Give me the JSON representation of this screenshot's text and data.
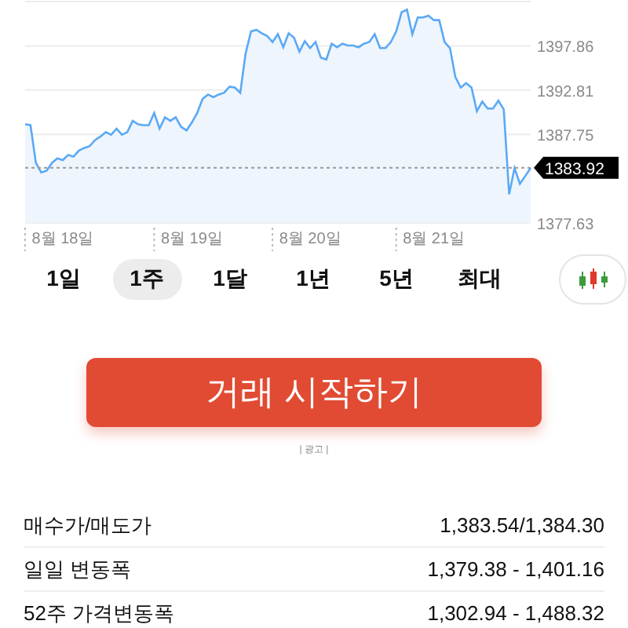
{
  "chart": {
    "chart_data": {
      "type": "area",
      "grid": true,
      "categories": [
        null,
        null,
        null,
        null,
        null,
        null,
        null,
        "8월 18일",
        null,
        null,
        null,
        null,
        null,
        null,
        null,
        null,
        null,
        null,
        null,
        null,
        null,
        null,
        null,
        null,
        null,
        null,
        null,
        null,
        null,
        null,
        null,
        "8월 19일",
        null,
        null,
        null,
        null,
        null,
        null,
        null,
        null,
        null,
        null,
        null,
        null,
        null,
        null,
        null,
        null,
        null,
        null,
        null,
        null,
        null,
        "8월 20일",
        null,
        null,
        null,
        null,
        null,
        null,
        null,
        null,
        null,
        null,
        null,
        null,
        null,
        null,
        null,
        null,
        null,
        null,
        null,
        null,
        null,
        null,
        "8월 21일",
        null,
        null,
        null,
        null,
        null,
        null,
        null,
        null,
        null,
        null,
        null,
        null,
        null,
        null,
        null,
        null,
        null,
        null
      ],
      "series": [
        {
          "color": "#5aa9f5",
          "values": [
            1388.9,
            1388.8,
            1384.5,
            1383.4,
            1383.6,
            1384.5,
            1385.0,
            1384.8,
            1385.4,
            1385.2,
            1385.9,
            1386.2,
            1386.4,
            1387.1,
            1387.5,
            1388.0,
            1387.7,
            1388.4,
            1387.7,
            1388.0,
            1389.3,
            1388.9,
            1388.8,
            1388.8,
            1390.2,
            1388.4,
            1389.7,
            1389.3,
            1389.7,
            1388.6,
            1388.2,
            1389.1,
            1390.2,
            1391.8,
            1392.3,
            1392.0,
            1392.3,
            1392.5,
            1393.2,
            1393.1,
            1392.5,
            1397.0,
            1399.5,
            1399.7,
            1399.3,
            1399.0,
            1398.3,
            1399.2,
            1397.7,
            1399.3,
            1398.8,
            1397.2,
            1398.4,
            1397.6,
            1398.3,
            1396.5,
            1396.3,
            1398.1,
            1397.7,
            1398.1,
            1397.9,
            1397.9,
            1397.7,
            1398.1,
            1398.3,
            1399.2,
            1397.6,
            1397.6,
            1398.3,
            1399.5,
            1401.7,
            1402.0,
            1399.2,
            1401.1,
            1401.1,
            1401.3,
            1400.8,
            1400.8,
            1398.3,
            1397.6,
            1394.3,
            1393.1,
            1393.6,
            1393.1,
            1390.4,
            1391.5,
            1390.7,
            1390.7,
            1391.6,
            1390.6,
            1380.9,
            1383.9,
            1382.1,
            1383.0,
            1383.9
          ]
        }
      ],
      "ylim": [
        1377.63,
        1402.92
      ],
      "yticks": [
        1377.63,
        1387.75,
        1392.81,
        1397.86
      ],
      "ref_lines": [
        {
          "axis": "y",
          "value": 1383.92,
          "label": "1383.92"
        }
      ]
    }
  },
  "ranges": [
    {
      "label": "1일",
      "selected": false
    },
    {
      "label": "1주",
      "selected": true
    },
    {
      "label": "1달",
      "selected": false
    },
    {
      "label": "1년",
      "selected": false
    },
    {
      "label": "5년",
      "selected": false
    },
    {
      "label": "최대",
      "selected": false
    }
  ],
  "trade_button": {
    "label": "거래 시작하기"
  },
  "ad_label": "| 광고 |",
  "stats": [
    {
      "label": "매수가/매도가",
      "value": "1,383.54/1,384.30"
    },
    {
      "label": "일일 변동폭",
      "value": "1,379.38 - 1,401.16"
    },
    {
      "label": "52주 가격변동폭",
      "value": "1,302.94 - 1,488.32"
    }
  ]
}
